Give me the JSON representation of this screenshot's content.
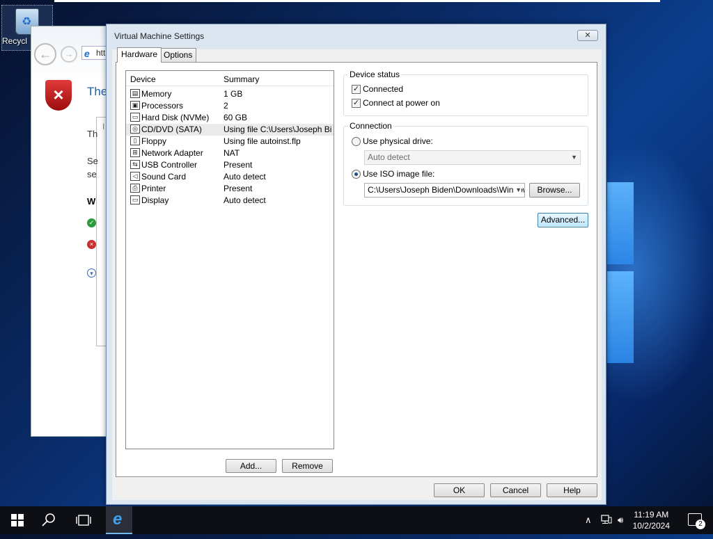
{
  "desktop": {
    "recycle_bin_label": "Recycl"
  },
  "ie_window": {
    "address_text": "htt",
    "title_text": "The",
    "line1": "Th",
    "line2": "Se",
    "line3": "se",
    "heading_fragment": "W",
    "inner_fragment": "I"
  },
  "dialog": {
    "title": "Virtual Machine Settings",
    "close_glyph": "✕",
    "tabs": [
      {
        "label": "Hardware",
        "active": true
      },
      {
        "label": "Options",
        "active": false
      }
    ],
    "device_list": {
      "col_device": "Device",
      "col_summary": "Summary",
      "rows": [
        {
          "icon": "memory-icon",
          "name": "Memory",
          "summary": "1 GB",
          "glyph": "▤"
        },
        {
          "icon": "processor-icon",
          "name": "Processors",
          "summary": "2",
          "glyph": "▣"
        },
        {
          "icon": "hard-disk-icon",
          "name": "Hard Disk (NVMe)",
          "summary": "60 GB",
          "glyph": "▭"
        },
        {
          "icon": "cd-dvd-icon",
          "name": "CD/DVD (SATA)",
          "summary": "Using file C:\\Users\\Joseph Bi...",
          "glyph": "◎",
          "selected": true
        },
        {
          "icon": "floppy-icon",
          "name": "Floppy",
          "summary": "Using file autoinst.flp",
          "glyph": "▯"
        },
        {
          "icon": "network-adapter-icon",
          "name": "Network Adapter",
          "summary": "NAT",
          "glyph": "⊞"
        },
        {
          "icon": "usb-controller-icon",
          "name": "USB Controller",
          "summary": "Present",
          "glyph": "⇆"
        },
        {
          "icon": "sound-card-icon",
          "name": "Sound Card",
          "summary": "Auto detect",
          "glyph": "◁"
        },
        {
          "icon": "printer-icon",
          "name": "Printer",
          "summary": "Present",
          "glyph": "⎙"
        },
        {
          "icon": "display-icon",
          "name": "Display",
          "summary": "Auto detect",
          "glyph": "▭"
        }
      ]
    },
    "add_button": "Add...",
    "remove_button": "Remove",
    "device_status": {
      "title": "Device status",
      "connected_label": "Connected",
      "connected_checked": true,
      "connect_at_power_on_label": "Connect at power on",
      "connect_at_power_on_checked": true
    },
    "connection": {
      "title": "Connection",
      "use_physical_drive_label": "Use physical drive:",
      "physical_drive_value": "Auto detect",
      "use_iso_label": "Use ISO image file:",
      "iso_path_value": "C:\\Users\\Joseph Biden\\Downloads\\Window",
      "browse_button": "Browse..."
    },
    "advanced_button": "Advanced...",
    "ok_button": "OK",
    "cancel_button": "Cancel",
    "help_button": "Help"
  },
  "taskbar": {
    "time": "11:19 AM",
    "date": "10/2/2024",
    "notification_count": "2"
  }
}
